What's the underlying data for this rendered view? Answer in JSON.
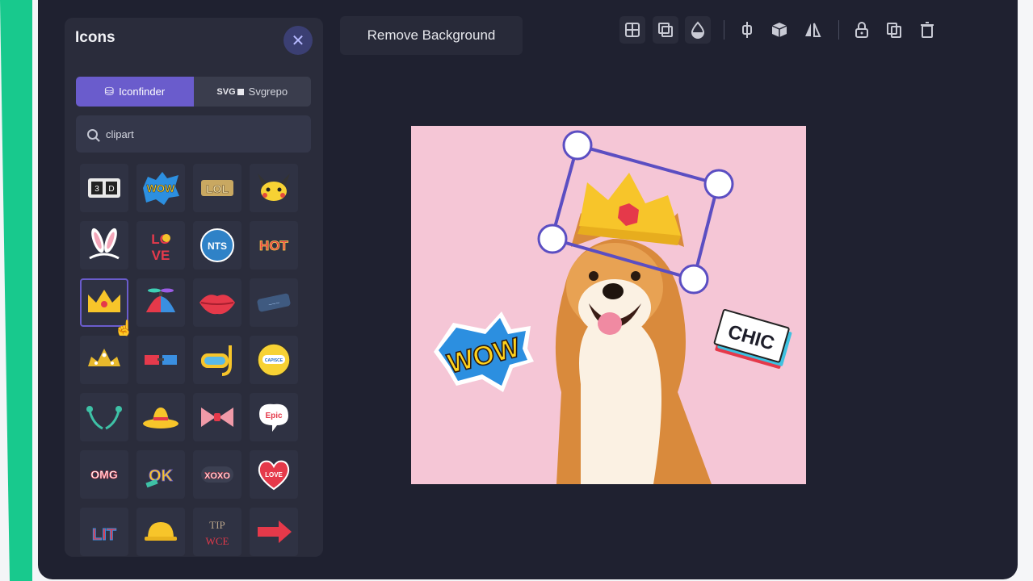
{
  "panel": {
    "title": "Icons",
    "close_icon": "close-icon",
    "tabs": [
      {
        "label": "Iconfinder",
        "icon": "iconfinder-icon",
        "active": true
      },
      {
        "label": "Svgrepo",
        "badge": "SVG",
        "icon": "svgrepo-icon",
        "active": false
      }
    ],
    "search": {
      "value": "clipart",
      "icon": "search-icon"
    },
    "selected_item": "crown",
    "icons": [
      [
        "3d-glasses-sticker",
        "wow-sticker",
        "lol-sticker",
        "pikachu-sticker"
      ],
      [
        "bunny-ears-sticker",
        "love-sticker",
        "nah-sticker",
        "hot-sticker"
      ],
      [
        "crown-sticker",
        "propeller-hat-sticker",
        "lips-sticker",
        "mustache-sticker"
      ],
      [
        "tiara-sticker",
        "3d-glasses-sticker",
        "snorkel-mask-sticker",
        "badge-sticker"
      ],
      [
        "antennae-sticker",
        "sombrero-sticker",
        "bow-tie-sticker",
        "epic-sticker"
      ],
      [
        "omg-sticker",
        "ok-sticker",
        "xoxo-sticker",
        "heart-sticker"
      ],
      [
        "lit-sticker",
        "hard-hat-sticker",
        "tip-sticker",
        "arrow-sticker"
      ]
    ],
    "sticker_text": {
      "wow": "WOW",
      "lol": "LOL",
      "love_top": "LO",
      "love_bottom": "VE",
      "nah": "NTS",
      "hot": "HOT",
      "badge": "CAPISCE",
      "epic": "Epic",
      "omg": "OMG",
      "ok": "OK",
      "xoxo": "XOXO",
      "heart": "LOVE",
      "lit": "LIT",
      "tip_top": "TIP",
      "tip_bottom": "WCE"
    }
  },
  "toolbar": {
    "remove_background": "Remove Background",
    "tools": [
      "align-icon",
      "layers-icon",
      "opacity-icon",
      "distribute-icon",
      "3d-icon",
      "flip-icon",
      "lock-icon",
      "duplicate-icon",
      "delete-icon"
    ]
  },
  "canvas": {
    "background_color": "#f5c6d6",
    "stickers": {
      "left": "WOW",
      "right": "CHIC"
    },
    "selection_color": "#5b4ec2"
  }
}
